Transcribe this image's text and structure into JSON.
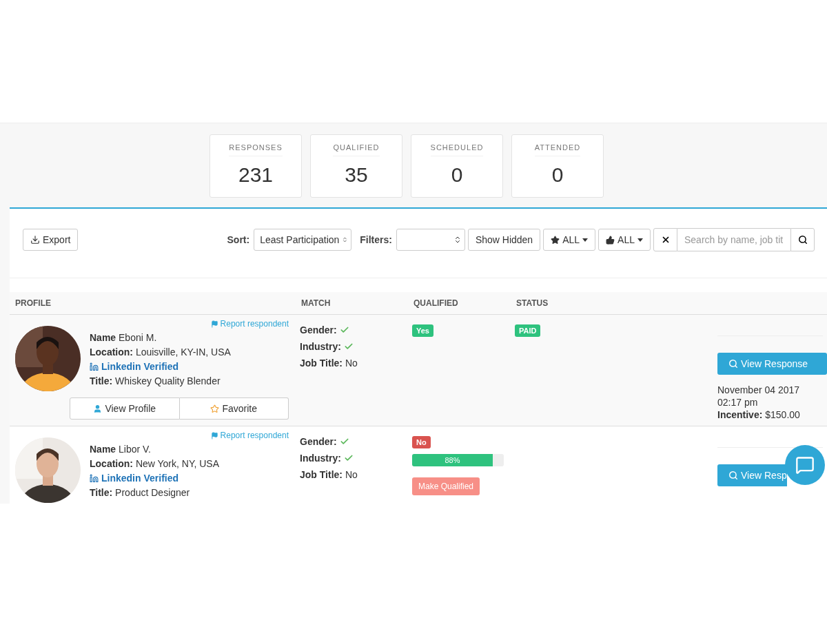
{
  "stats": [
    {
      "label": "RESPONSES",
      "value": "231"
    },
    {
      "label": "QUALIFIED",
      "value": "35"
    },
    {
      "label": "SCHEDULED",
      "value": "0"
    },
    {
      "label": "ATTENDED",
      "value": "0"
    }
  ],
  "toolbar": {
    "export": "Export",
    "sort_label": "Sort:",
    "sort_value": "Least Participation",
    "filters_label": "Filters:",
    "show_hidden": "Show Hidden",
    "star_filter": "ALL",
    "thumb_filter": "ALL",
    "search": {
      "placeholder": "Search by name, job tit"
    }
  },
  "table": {
    "columns": [
      "PROFILE",
      "MATCH",
      "QUALIFIED",
      "STATUS"
    ],
    "rows": [
      {
        "report": "Report respondent",
        "name_label": "Name",
        "name": "Eboni M.",
        "location_label": "Location:",
        "location": "Louisville, KY-IN, USA",
        "linkedin": "Linkedin Verified",
        "title_label": "Title:",
        "title": "Whiskey Quality Blender",
        "actions": [
          "View Profile",
          "Favorite"
        ],
        "match": [
          {
            "kind": "check",
            "label": "Gender:"
          },
          {
            "kind": "check",
            "label": "Industry:"
          },
          {
            "kind": "text",
            "label": "Job Title:",
            "value": "No"
          }
        ],
        "qualified": {
          "text": "Yes",
          "color": "#2ec27e"
        },
        "status": "PAID",
        "view_response": "View Response",
        "date": "November 04 2017",
        "time": "02:17 pm",
        "incentive_label": "Incentive:",
        "incentive": "$150.00"
      },
      {
        "report": "Report respondent",
        "name_label": "Name",
        "name": "Libor V.",
        "location_label": "Location:",
        "location": "New York, NY, USA",
        "linkedin": "Linkedin Verified",
        "title_label": "Title:",
        "title": "Product Designer",
        "match": [
          {
            "kind": "check",
            "label": "Gender:"
          },
          {
            "kind": "check",
            "label": "Industry:"
          },
          {
            "kind": "text",
            "label": "Job Title:",
            "value": "No"
          }
        ],
        "qualified": {
          "text": "No",
          "color": "#d9534f"
        },
        "progress": {
          "level": 0.88,
          "reading": "88%"
        },
        "make_qualified": "Make Qualified",
        "view_response": "View Resp"
      }
    ]
  }
}
